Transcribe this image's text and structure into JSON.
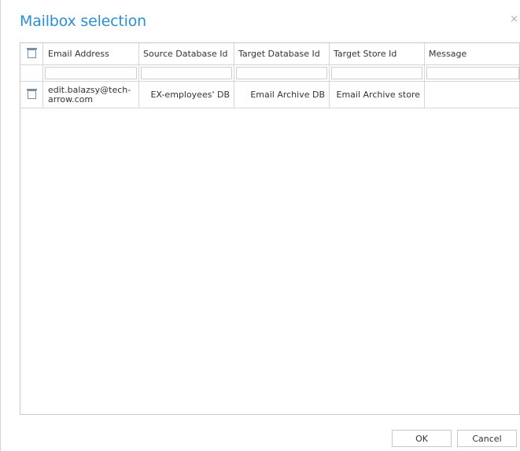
{
  "dialog": {
    "title": "Mailbox selection",
    "close_glyph": "×"
  },
  "table": {
    "headers": [
      "Email Address",
      "Source Database Id",
      "Target Database Id",
      "Target Store Id",
      "Message"
    ],
    "filters": [
      "",
      "",
      "",
      "",
      ""
    ],
    "rows": [
      {
        "email": "edit.balazsy@tech-arrow.com",
        "source_db": "EX-employees' DB",
        "target_db": "Email Archive DB",
        "target_store": "Email Archive store",
        "message": ""
      }
    ]
  },
  "buttons": {
    "ok": "OK",
    "cancel": "Cancel"
  },
  "colors": {
    "title": "#2b8fd6",
    "border": "#c9c9c9"
  }
}
